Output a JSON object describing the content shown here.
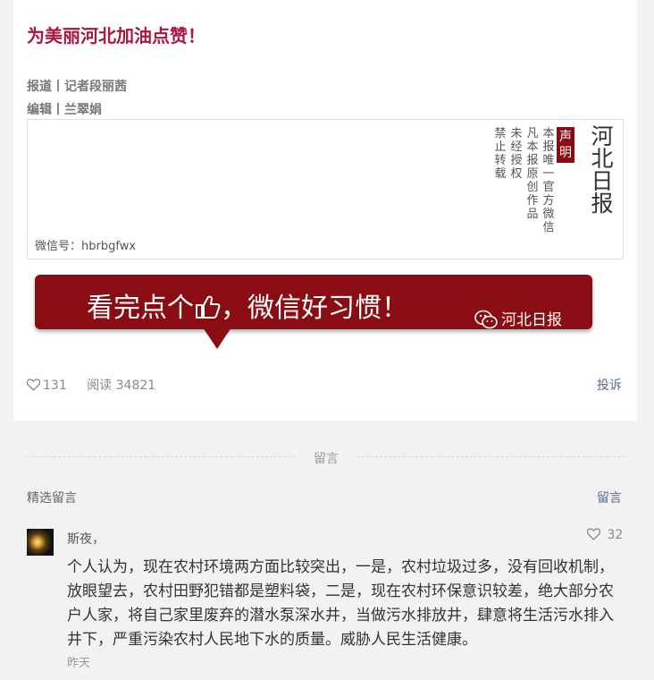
{
  "article": {
    "headline": "为美丽河北加油点赞！",
    "reporter_line": "报道丨记者段丽茜",
    "editor_line": "编辑丨兰翠娟"
  },
  "banner": {
    "wechat_id": "微信号：hbrbgfwx",
    "notice_tag": "声明",
    "notice_cols": [
      "本报唯一官方微信",
      "凡本报原创作品",
      "未经授权",
      "禁止转载"
    ],
    "logo_text": "河北日报"
  },
  "cta": {
    "text_before": "看完点个",
    "text_after": "，微信好习惯！",
    "brand": "河北日报",
    "icon": "thumbs-up-icon"
  },
  "stats": {
    "likes": "131",
    "reads_label": "阅读",
    "reads": "34821",
    "report": "投诉"
  },
  "comments_section": {
    "divider_label": "留言",
    "featured_title": "精选留言",
    "write_link": "留言",
    "items": [
      {
        "name": "斯夜，",
        "likes": "32",
        "body": "个人认为，现在农村环境两方面比较突出，一是，农村垃圾过多，没有回收机制，放眼望去，农村田野犯错都是塑料袋，二是，现在农村环保意识较差，绝大部分农户人家，将自己家里废弃的潜水泵深水井，当做污水排放井，肆意将生活污水排入井下，严重污染农村人民地下水的质量。威胁人民生活健康。",
        "time": "昨天"
      }
    ]
  },
  "colors": {
    "headline": "#a8193f",
    "banner_red": "#8b0d14",
    "link": "#576b95"
  }
}
